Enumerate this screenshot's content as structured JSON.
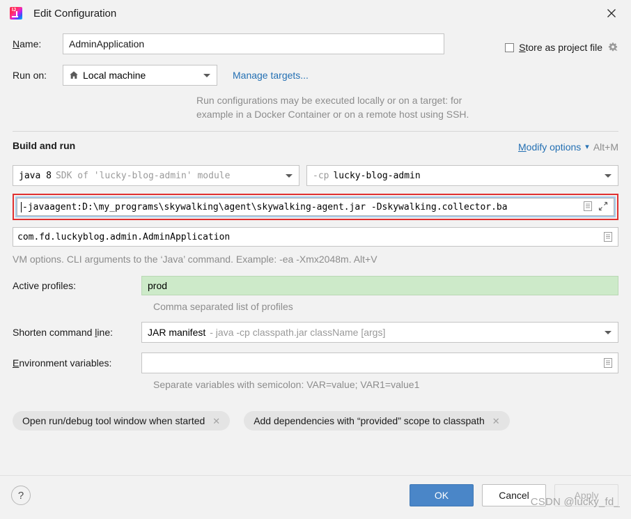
{
  "window": {
    "title": "Edit Configuration",
    "app_icon": "intellij-idea-icon",
    "close_icon": "close-icon"
  },
  "name_row": {
    "label": "Name:",
    "label_mnemonic": "N",
    "value": "AdminApplication",
    "store_as_project_file_label": "Store as project file",
    "store_as_project_file_mnemonic": "S",
    "store_checked": false,
    "gear_icon": "gear-icon"
  },
  "run_on": {
    "label": "Run on:",
    "value": "Local machine",
    "icon": "home-icon",
    "manage_targets_link": "Manage targets...",
    "hint_line1": "Run configurations may be executed locally or on a target: for",
    "hint_line2": "example in a Docker Container or on a remote host using SSH."
  },
  "build_and_run": {
    "section_title": "Build and run",
    "modify_options_label": "Modify options",
    "modify_options_mnemonic": "M",
    "modify_options_shortcut": "Alt+M",
    "chevron_icon": "chevron-down-icon",
    "sdk": {
      "primary": "java 8",
      "secondary": "SDK of 'lucky-blog-admin' module"
    },
    "classpath": {
      "primary": "-cp",
      "secondary": "lucky-blog-admin"
    },
    "vm_options": {
      "value": "-javaagent:D:\\my_programs\\skywalking\\agent\\skywalking-agent.jar -Dskywalking.collector.ba",
      "focused": true,
      "highlight_color": "#e03030",
      "expand_icon": "expand-icon",
      "document_icon": "document-icon"
    },
    "main_class": {
      "value": "com.fd.luckyblog.admin.AdminApplication",
      "document_icon": "document-icon"
    },
    "vm_hint": "VM options. CLI arguments to the ‘Java’ command. Example: -ea -Xmx2048m. Alt+V"
  },
  "active_profiles": {
    "label": "Active profiles:",
    "value": "prod",
    "hint": "Comma separated list of profiles",
    "background_color": "#cdeac9"
  },
  "shorten_command_line": {
    "label": "Shorten command line:",
    "label_mnemonic": "l",
    "value_primary": "JAR manifest",
    "value_secondary": "- java -cp classpath.jar className [args]"
  },
  "environment_variables": {
    "label": "Environment variables:",
    "label_mnemonic": "E",
    "value": "",
    "hint": "Separate variables with semicolon: VAR=value; VAR1=value1",
    "document_icon": "document-icon"
  },
  "option_tags": [
    {
      "label": "Open run/debug tool window when started",
      "remove_icon": "close-icon"
    },
    {
      "label": "Add dependencies with “provided” scope to classpath",
      "remove_icon": "close-icon"
    }
  ],
  "footer": {
    "help_label": "?",
    "ok_label": "OK",
    "cancel_label": "Cancel",
    "apply_label": "Apply",
    "apply_enabled": false,
    "ok_color": "#4a86c8"
  },
  "watermark": "CSDN @lucky_fd_"
}
